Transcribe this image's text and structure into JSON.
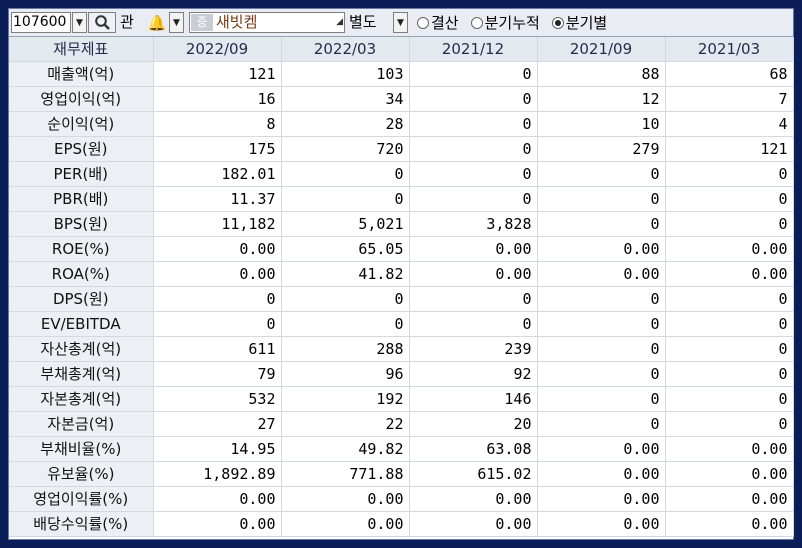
{
  "toolbar": {
    "code_value": "107600",
    "search_icon": "magnifier-icon",
    "gwan_label": "관",
    "bell_icon": "bell-icon",
    "badge_label": "증",
    "company_name": "새빗켐",
    "byeoldo_label": "별도",
    "radio_options": [
      {
        "label": "결산",
        "selected": false
      },
      {
        "label": "분기누적",
        "selected": false
      },
      {
        "label": "분기별",
        "selected": true
      }
    ]
  },
  "table": {
    "header_label": "재무제표",
    "columns": [
      "2022/09",
      "2022/03",
      "2021/12",
      "2021/09",
      "2021/03"
    ],
    "rows": [
      {
        "label": "매출액(억)",
        "values": [
          "121",
          "103",
          "0",
          "88",
          "68"
        ]
      },
      {
        "label": "영업이익(억)",
        "values": [
          "16",
          "34",
          "0",
          "12",
          "7"
        ]
      },
      {
        "label": "순이익(억)",
        "values": [
          "8",
          "28",
          "0",
          "10",
          "4"
        ]
      },
      {
        "label": "EPS(원)",
        "values": [
          "175",
          "720",
          "0",
          "279",
          "121"
        ]
      },
      {
        "label": "PER(배)",
        "values": [
          "182.01",
          "0",
          "0",
          "0",
          "0"
        ]
      },
      {
        "label": "PBR(배)",
        "values": [
          "11.37",
          "0",
          "0",
          "0",
          "0"
        ]
      },
      {
        "label": "BPS(원)",
        "values": [
          "11,182",
          "5,021",
          "3,828",
          "0",
          "0"
        ]
      },
      {
        "label": "ROE(%)",
        "values": [
          "0.00",
          "65.05",
          "0.00",
          "0.00",
          "0.00"
        ]
      },
      {
        "label": "ROA(%)",
        "values": [
          "0.00",
          "41.82",
          "0.00",
          "0.00",
          "0.00"
        ]
      },
      {
        "label": "DPS(원)",
        "values": [
          "0",
          "0",
          "0",
          "0",
          "0"
        ]
      },
      {
        "label": "EV/EBITDA",
        "values": [
          "0",
          "0",
          "0",
          "0",
          "0"
        ]
      },
      {
        "label": "자산총계(억)",
        "values": [
          "611",
          "288",
          "239",
          "0",
          "0"
        ]
      },
      {
        "label": "부채총계(억)",
        "values": [
          "79",
          "96",
          "92",
          "0",
          "0"
        ]
      },
      {
        "label": "자본총계(억)",
        "values": [
          "532",
          "192",
          "146",
          "0",
          "0"
        ]
      },
      {
        "label": "자본금(억)",
        "values": [
          "27",
          "22",
          "20",
          "0",
          "0"
        ]
      },
      {
        "label": "부채비율(%)",
        "values": [
          "14.95",
          "49.82",
          "63.08",
          "0.00",
          "0.00"
        ]
      },
      {
        "label": "유보율(%)",
        "values": [
          "1,892.89",
          "771.88",
          "615.02",
          "0.00",
          "0.00"
        ]
      },
      {
        "label": "영업이익률(%)",
        "values": [
          "0.00",
          "0.00",
          "0.00",
          "0.00",
          "0.00"
        ]
      },
      {
        "label": "배당수익률(%)",
        "values": [
          "0.00",
          "0.00",
          "0.00",
          "0.00",
          "0.00"
        ]
      }
    ]
  }
}
